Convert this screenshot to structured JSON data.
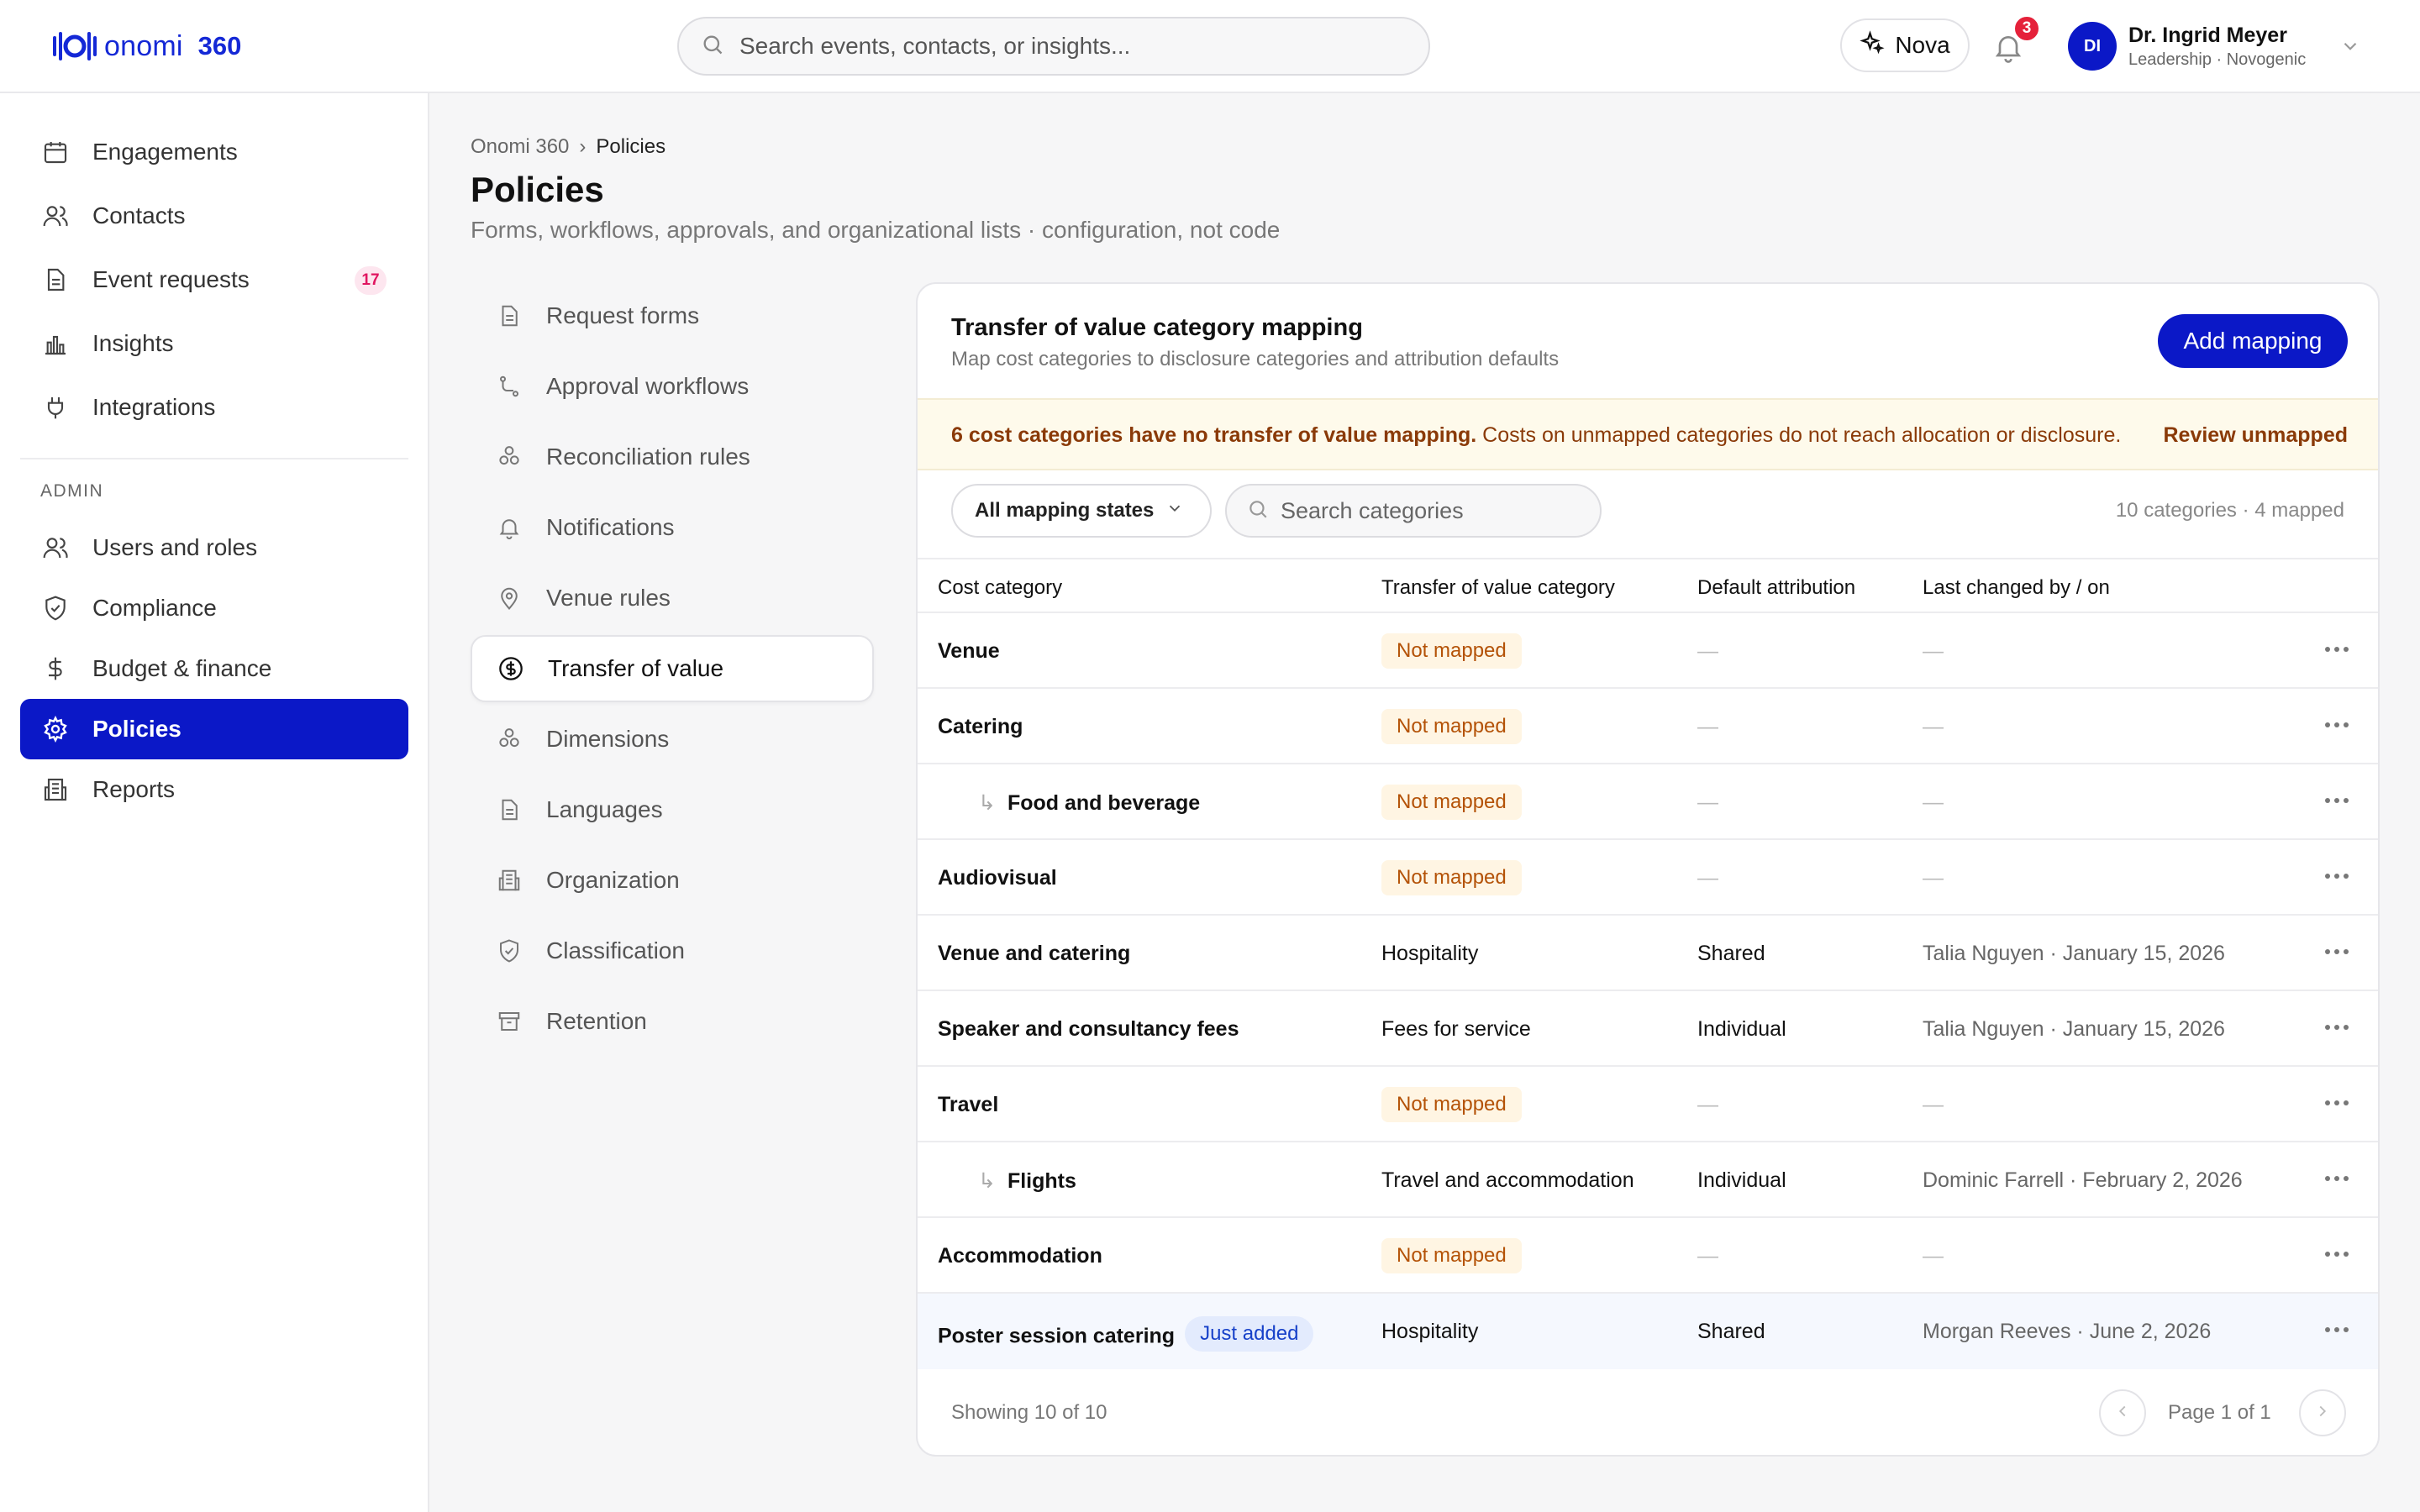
{
  "app": {
    "logo_text": "onomi",
    "logo_num": "360",
    "brand_color": "#1428d6",
    "accent_color": "#0b18c7"
  },
  "header": {
    "search_placeholder": "Search events, contacts, or insights...",
    "nova_label": "Nova",
    "notification_count": "3",
    "user_initials": "DI",
    "user_name": "Dr. Ingrid Meyer",
    "user_role": "Leadership · Novogenic"
  },
  "sidebar": {
    "items": [
      {
        "label": "Engagements",
        "icon": "calendar-icon"
      },
      {
        "label": "Contacts",
        "icon": "users-icon"
      },
      {
        "label": "Event requests",
        "icon": "document-icon",
        "badge": "17"
      },
      {
        "label": "Insights",
        "icon": "bar-chart-icon"
      },
      {
        "label": "Integrations",
        "icon": "plug-icon"
      }
    ],
    "section_label": "ADMIN",
    "admin_items": [
      {
        "label": "Users and roles",
        "icon": "users-icon"
      },
      {
        "label": "Compliance",
        "icon": "shield-check-icon"
      },
      {
        "label": "Budget & finance",
        "icon": "dollar-icon"
      },
      {
        "label": "Policies",
        "icon": "gear-icon",
        "active": true
      },
      {
        "label": "Reports",
        "icon": "building-icon"
      }
    ]
  },
  "page": {
    "breadcrumb_root": "Onomi 360",
    "breadcrumb_sep": "›",
    "breadcrumb_current": "Policies",
    "title": "Policies",
    "subtitle": "Forms, workflows, approvals, and organizational lists · configuration, not code"
  },
  "subnav": {
    "items": [
      {
        "label": "Request forms",
        "icon": "document-icon"
      },
      {
        "label": "Approval workflows",
        "icon": "workflow-icon"
      },
      {
        "label": "Reconciliation rules",
        "icon": "blocks-icon"
      },
      {
        "label": "Notifications",
        "icon": "bell-icon"
      },
      {
        "label": "Venue rules",
        "icon": "map-pin-icon"
      },
      {
        "label": "Transfer of value",
        "icon": "dollar-circle-icon",
        "active": true
      },
      {
        "label": "Dimensions",
        "icon": "blocks-icon"
      },
      {
        "label": "Languages",
        "icon": "document-icon"
      },
      {
        "label": "Organization",
        "icon": "building-icon"
      },
      {
        "label": "Classification",
        "icon": "shield-check-icon"
      },
      {
        "label": "Retention",
        "icon": "archive-icon"
      }
    ]
  },
  "card": {
    "title": "Transfer of value category mapping",
    "subtitle": "Map cost categories to disclosure categories and attribution defaults",
    "add_button": "Add mapping",
    "warning_bold": "6 cost categories have no transfer of value mapping.",
    "warning_text": " Costs on unmapped categories do not reach allocation or disclosure.",
    "warning_link": "Review unmapped",
    "filter_label": "All mapping states",
    "search_placeholder": "Search categories",
    "count_text": "10 categories · 4 mapped",
    "columns": [
      "Cost category",
      "Transfer of value category",
      "Default attribution",
      "Last changed by / on"
    ],
    "rows": [
      {
        "name": "Venue",
        "child": false,
        "tov": "Not mapped",
        "mapped": false,
        "attribution": "—",
        "changed": "—"
      },
      {
        "name": "Catering",
        "child": false,
        "tov": "Not mapped",
        "mapped": false,
        "attribution": "—",
        "changed": "—"
      },
      {
        "name": "Food and beverage",
        "child": true,
        "tov": "Not mapped",
        "mapped": false,
        "attribution": "—",
        "changed": "—"
      },
      {
        "name": "Audiovisual",
        "child": false,
        "tov": "Not mapped",
        "mapped": false,
        "attribution": "—",
        "changed": "—"
      },
      {
        "name": "Venue and catering",
        "child": false,
        "tov": "Hospitality",
        "mapped": true,
        "attribution": "Shared",
        "changed": "Talia Nguyen · January 15, 2026"
      },
      {
        "name": "Speaker and consultancy fees",
        "child": false,
        "tov": "Fees for service",
        "mapped": true,
        "attribution": "Individual",
        "changed": "Talia Nguyen · January 15, 2026"
      },
      {
        "name": "Travel",
        "child": false,
        "tov": "Not mapped",
        "mapped": false,
        "attribution": "—",
        "changed": "—"
      },
      {
        "name": "Flights",
        "child": true,
        "tov": "Travel and accommodation",
        "mapped": true,
        "attribution": "Individual",
        "changed": "Dominic Farrell · February 2, 2026"
      },
      {
        "name": "Accommodation",
        "child": false,
        "tov": "Not mapped",
        "mapped": false,
        "attribution": "—",
        "changed": "—"
      },
      {
        "name": "Poster session catering",
        "child": false,
        "badge": "Just added",
        "tov": "Hospitality",
        "mapped": true,
        "attribution": "Shared",
        "changed": "Morgan Reeves · June 2, 2026",
        "highlight": true
      }
    ],
    "footer_text": "Showing 10 of 10",
    "page_text": "Page 1 of 1"
  }
}
